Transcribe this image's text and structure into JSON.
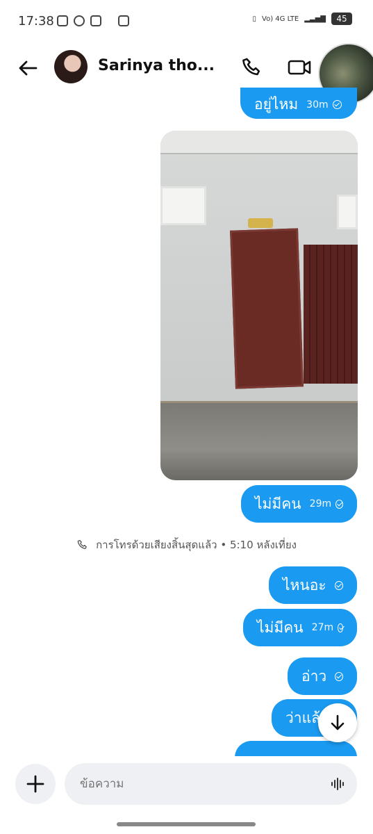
{
  "status_bar": {
    "time": "17:38",
    "network": "Vo) 4G LTE",
    "battery": "45"
  },
  "header": {
    "contact_name": "Sarinya tho..."
  },
  "messages": [
    {
      "text": "อยู่ไหม",
      "time": "30m"
    },
    {
      "text": "ไม่มีคน",
      "time": "29m"
    },
    {
      "text": "ไหนอะ",
      "time": ""
    },
    {
      "text": "ไม่มีคน",
      "time": "27m"
    },
    {
      "text": "อ่าว",
      "time": ""
    },
    {
      "text": "ว่าแล้",
      "time": ""
    }
  ],
  "system_event": {
    "text": "การโทรด้วยเสียงสิ้นสุดแล้ว • 5:10 หลังเที่ยง"
  },
  "composer": {
    "placeholder": "ข้อความ"
  },
  "colors": {
    "bubble": "#1a9af0",
    "input_bg": "#eef0f3"
  }
}
